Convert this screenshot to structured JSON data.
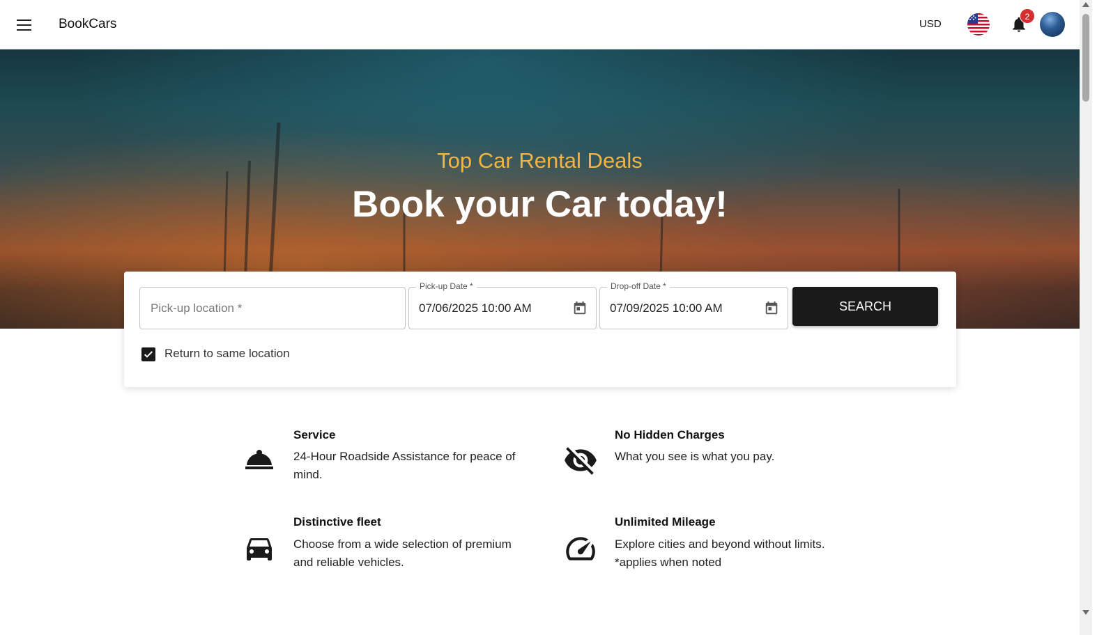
{
  "header": {
    "brand": "BookCars",
    "currency": "USD",
    "notifications_count": "2",
    "icons": [
      "menu-icon",
      "us-flag-icon",
      "bell-icon",
      "avatar"
    ]
  },
  "hero": {
    "subtitle": "Top Car Rental Deals",
    "title": "Book your Car today!"
  },
  "search": {
    "pickup_location_placeholder": "Pick-up location *",
    "pickup_date_label": "Pick-up Date *",
    "pickup_date_value": "07/06/2025 10:00 AM",
    "dropoff_date_label": "Drop-off Date *",
    "dropoff_date_value": "07/09/2025 10:00 AM",
    "search_button": "SEARCH",
    "same_location_label": "Return to same location",
    "same_location_checked": true
  },
  "features": [
    {
      "icon": "room-service-icon",
      "title": "Service",
      "text": "24-Hour Roadside Assistance for peace of mind."
    },
    {
      "icon": "visibility-off-icon",
      "title": "No Hidden Charges",
      "text": "What you see is what you pay."
    },
    {
      "icon": "car-icon",
      "title": "Distinctive fleet",
      "text": "Choose from a wide selection of premium and reliable vehicles."
    },
    {
      "icon": "speedometer-icon",
      "title": "Unlimited Mileage",
      "text": "Explore cities and beyond without limits. *applies when noted"
    }
  ],
  "colors": {
    "accent": "#f5b342",
    "button": "#1a1a1a",
    "badge": "#d32f2f"
  }
}
